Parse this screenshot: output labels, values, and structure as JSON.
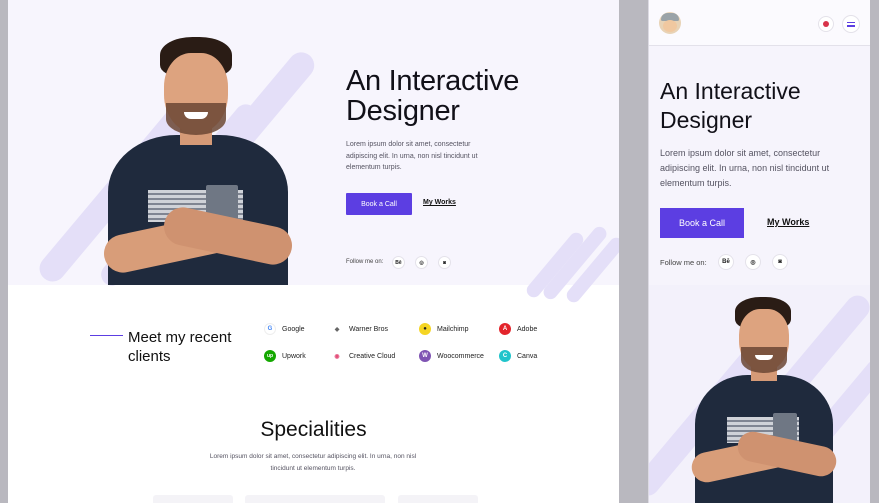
{
  "desktop": {
    "hero": {
      "title": "An Interactive Designer",
      "description": "Lorem ipsum dolor sit amet, consectetur adipiscing elit. In urna, non nisl tincidunt ut elementum turpis.",
      "book_label": "Book a Call",
      "works_label": "My Works",
      "follow_label": "Follow me on:",
      "social": [
        {
          "icon": "behance-icon",
          "glyph": "Bē"
        },
        {
          "icon": "dribbble-icon",
          "glyph": "◎"
        },
        {
          "icon": "instagram-icon",
          "glyph": "◙"
        }
      ]
    },
    "clients": {
      "title": "Meet my recent clients",
      "items": [
        {
          "name": "Google",
          "icon": "google-logo",
          "color": "#ffffff",
          "glyph": "G"
        },
        {
          "name": "Warner Bros",
          "icon": "warner-bros-logo",
          "color": "#ffffff",
          "glyph": "◆"
        },
        {
          "name": "Mailchimp",
          "icon": "mailchimp-logo",
          "color": "#f5d524",
          "glyph": "●"
        },
        {
          "name": "Adobe",
          "icon": "adobe-logo",
          "color": "#e3242b",
          "glyph": "A"
        },
        {
          "name": "Upwork",
          "icon": "upwork-logo",
          "color": "#14a800",
          "glyph": "up"
        },
        {
          "name": "Creative Cloud",
          "icon": "creative-cloud-logo",
          "color": "#ffffff",
          "glyph": "◉"
        },
        {
          "name": "Woocommerce",
          "icon": "woocommerce-logo",
          "color": "#7f54b3",
          "glyph": "W"
        },
        {
          "name": "Canva",
          "icon": "canva-logo",
          "color": "#20c4cb",
          "glyph": "C"
        }
      ]
    },
    "specialities": {
      "title": "Specialities",
      "description": "Lorem ipsum dolor sit amet, consectetur adipiscing elit. In urna, non nisl tincidunt ut elementum turpis."
    }
  },
  "mobile": {
    "title": "An Interactive Designer",
    "description": "Lorem ipsum dolor sit amet, consectetur adipiscing elit. In urna, non nisl tincidunt ut elementum turpis.",
    "book_label": "Book a Call",
    "works_label": "My Works",
    "follow_label": "Follow me on:",
    "social": [
      {
        "icon": "behance-icon",
        "glyph": "Bē"
      },
      {
        "icon": "dribbble-icon",
        "glyph": "◎"
      },
      {
        "icon": "instagram-icon",
        "glyph": "◙"
      }
    ]
  },
  "colors": {
    "accent": "#5c3ee2",
    "hero_bg": "#f7f5fd",
    "stripe": "#e4dff8"
  }
}
